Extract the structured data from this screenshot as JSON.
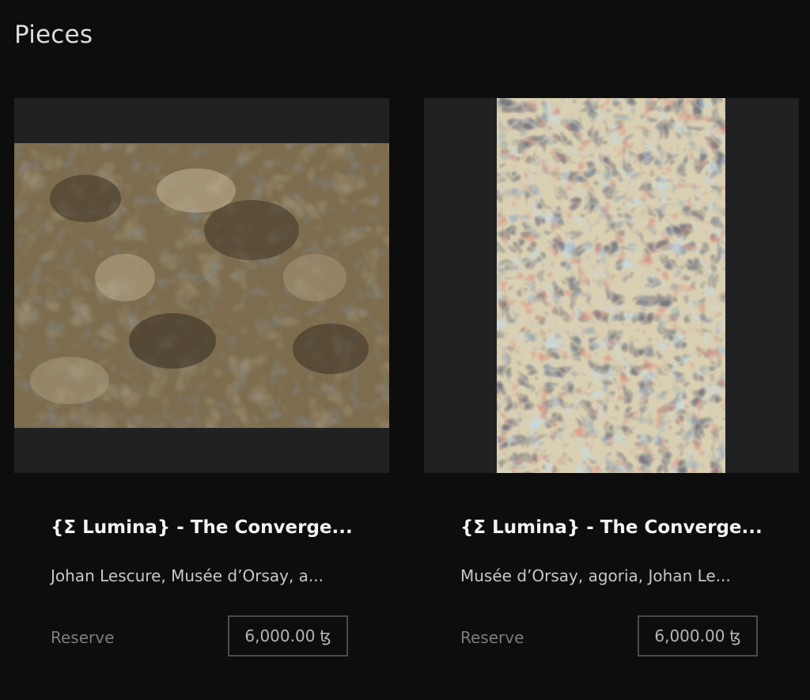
{
  "page": {
    "title": "Pieces"
  },
  "pieces": [
    {
      "title": "{Σ Lumina} - The Converge...",
      "artists": "Johan Lescure, Musée d’Orsay, a...",
      "status": "Reserve",
      "price": "6,000.00",
      "currency_symbol": "ꜩ",
      "artwork_icon": "landscape-artwork-image"
    },
    {
      "title": "{Σ Lumina} - The Converge...",
      "artists": "Musée d’Orsay, agoria, Johan Le...",
      "status": "Reserve",
      "price": "6,000.00",
      "currency_symbol": "ꜩ",
      "artwork_icon": "portrait-artwork-image"
    }
  ]
}
